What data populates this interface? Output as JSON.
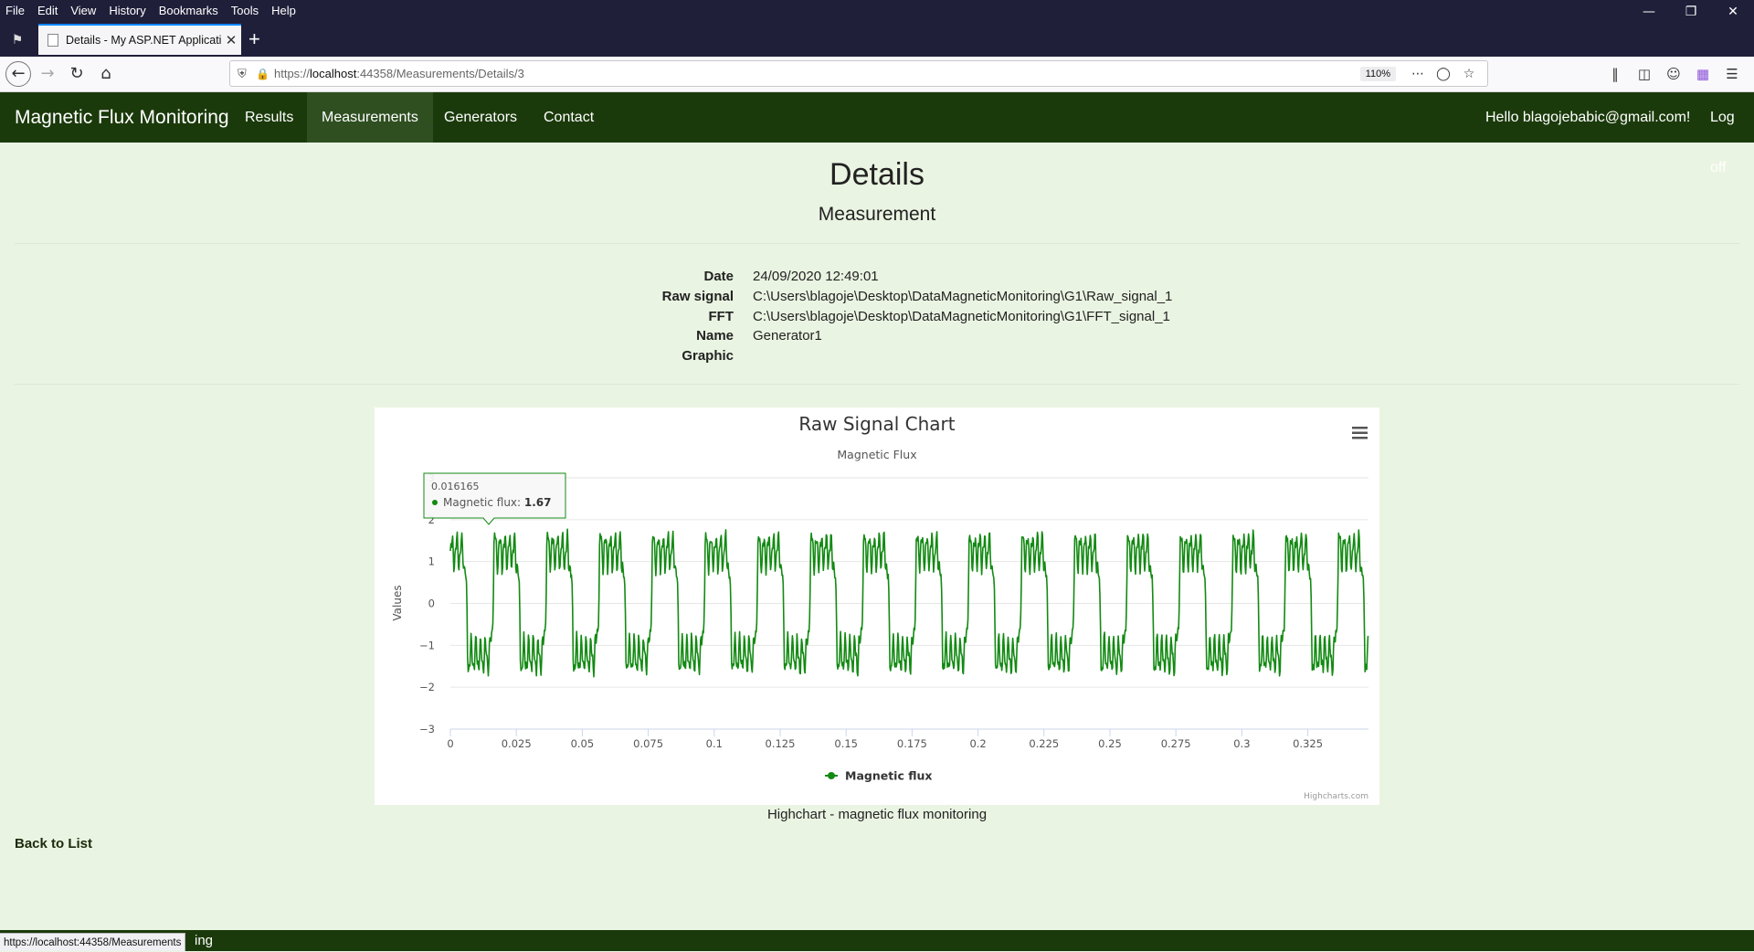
{
  "browser": {
    "menu": [
      "File",
      "Edit",
      "View",
      "History",
      "Bookmarks",
      "Tools",
      "Help"
    ],
    "tab_title": "Details - My ASP.NET Applicati",
    "url_prefix": "https://",
    "url_host": "localhost",
    "url_rest": ":44358/Measurements/Details/3",
    "zoom": "110%",
    "status_url": "https://localhost:44358/Measurements"
  },
  "site": {
    "brand": "Magnetic Flux Monitoring",
    "nav": {
      "results": "Results",
      "measurements": "Measurements",
      "generators": "Generators",
      "contact": "Contact",
      "hello": "Hello blagojebabic@gmail.com!",
      "logoff": "Log off"
    }
  },
  "page": {
    "title": "Details",
    "subtitle": "Measurement",
    "fields": {
      "date_label": "Date",
      "date_value": "24/09/2020 12:49:01",
      "raw_label": "Raw signal",
      "raw_value": "C:\\Users\\blagoje\\Desktop\\DataMagneticMonitoring\\G1\\Raw_signal_1",
      "fft_label": "FFT",
      "fft_value": "C:\\Users\\blagoje\\Desktop\\DataMagneticMonitoring\\G1\\FFT_signal_1",
      "name_label": "Name",
      "name_value": "Generator1",
      "graphic_label": "Graphic"
    },
    "chart_caption": "Highchart - magnetic flux monitoring",
    "back_link": "Back to List",
    "footer_text": "ing"
  },
  "chart_data": {
    "type": "line",
    "title": "Raw Signal Chart",
    "subtitle": "Magnetic Flux",
    "ylabel": "Values",
    "xlabel": "",
    "xlim": [
      0,
      0.348
    ],
    "ylim": [
      -3,
      3
    ],
    "x_ticks": [
      "0",
      "0.025",
      "0.05",
      "0.075",
      "0.1",
      "0.125",
      "0.15",
      "0.175",
      "0.2",
      "0.225",
      "0.25",
      "0.275",
      "0.3",
      "0.325"
    ],
    "y_ticks": [
      "3",
      "2",
      "1",
      "0",
      "−1",
      "−2",
      "−3"
    ],
    "grid": true,
    "legend": "bottom-center",
    "period": 0.02,
    "color": "#138a13",
    "series": [
      {
        "name": "Magnetic flux"
      }
    ],
    "tooltip": {
      "x": "0.016165",
      "label": "Magnetic flux",
      "value": "1.67"
    },
    "credits": "Highcharts.com"
  }
}
